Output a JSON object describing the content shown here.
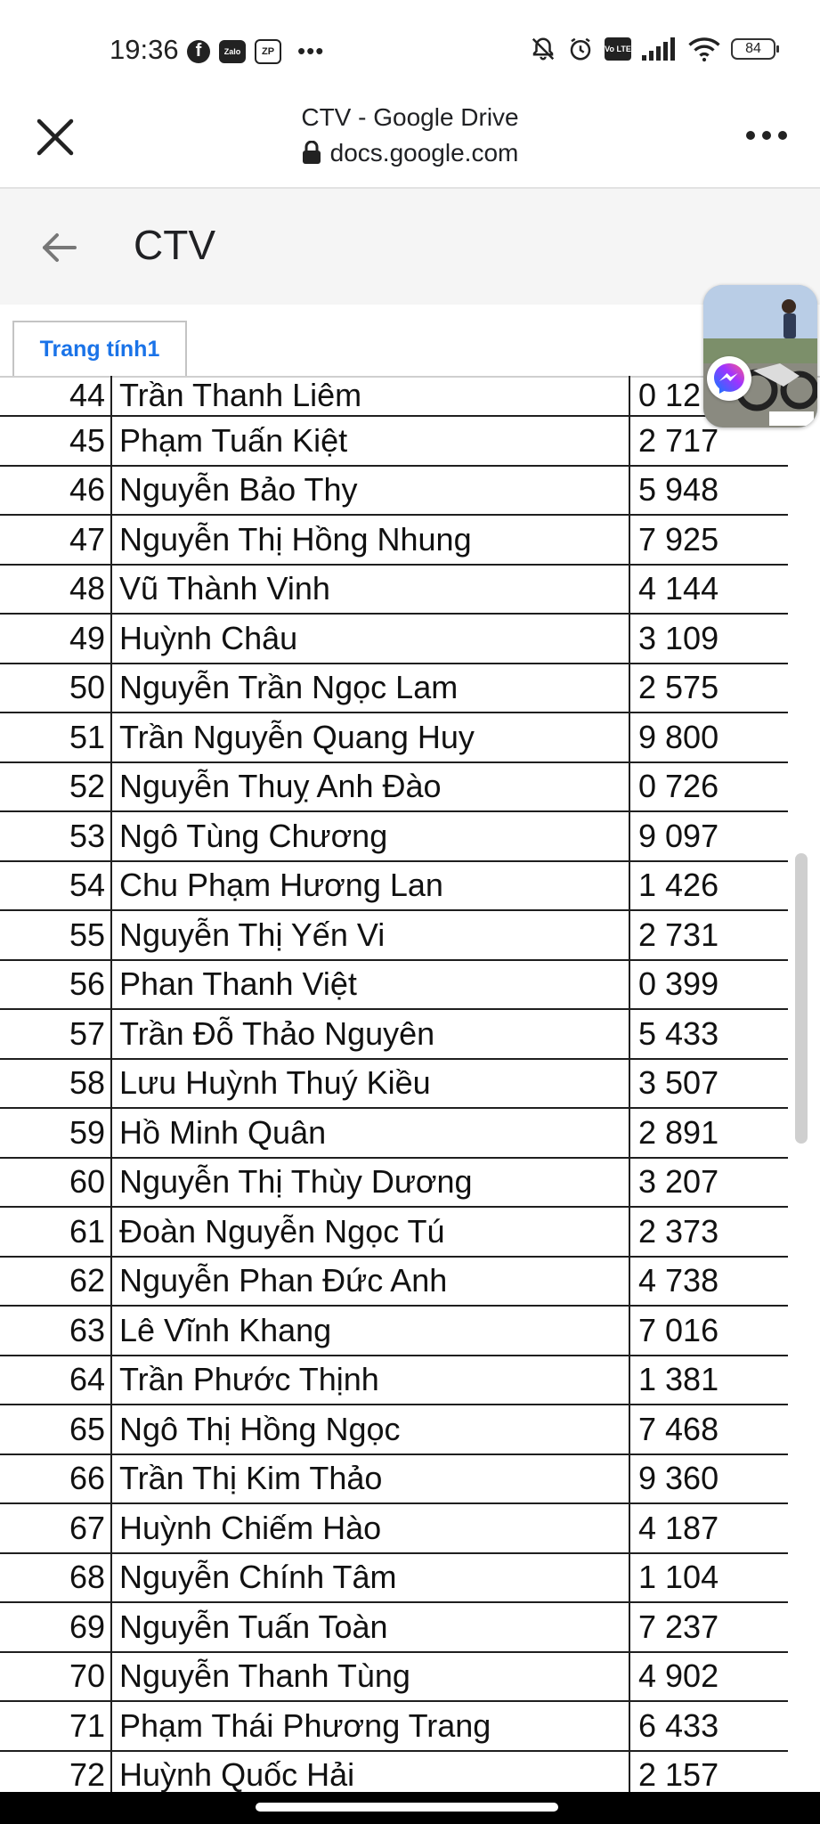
{
  "status_bar": {
    "time": "19:36",
    "left_icons": [
      "facebook-icon",
      "zalo-icon",
      "zp-icon",
      "more-dots-icon"
    ],
    "zalo_label": "Zalo",
    "zp_label": "ZP",
    "right_icons": [
      "mute-bell-icon",
      "alarm-icon",
      "volte-icon",
      "signal-icon",
      "wifi-icon",
      "battery-icon"
    ],
    "volte_label": "Vo LTE",
    "battery": "84"
  },
  "browser": {
    "title": "CTV - Google Drive",
    "url": "docs.google.com"
  },
  "app": {
    "doc_title": "CTV"
  },
  "sheet_tabs": [
    {
      "label": "Trang tính1",
      "active": true
    }
  ],
  "rows": [
    {
      "num": "44",
      "name": "Trần Thanh Liêm",
      "phone": "0 12"
    },
    {
      "num": "45",
      "name": "Phạm Tuấn Kiệt",
      "phone": "2 717"
    },
    {
      "num": "46",
      "name": "Nguyễn Bảo Thy",
      "phone": "5 948"
    },
    {
      "num": "47",
      "name": "Nguyễn Thị Hồng Nhung",
      "phone": "7 925"
    },
    {
      "num": "48",
      "name": "Vũ Thành Vinh",
      "phone": "4 144"
    },
    {
      "num": "49",
      "name": "Huỳnh Châu",
      "phone": "3 109"
    },
    {
      "num": "50",
      "name": "Nguyễn Trần Ngọc Lam",
      "phone": "2 575"
    },
    {
      "num": "51",
      "name": "Trần Nguyễn Quang Huy",
      "phone": "9 800"
    },
    {
      "num": "52",
      "name": "Nguyễn Thuỵ Anh Đào",
      "phone": "0 726"
    },
    {
      "num": "53",
      "name": "Ngô Tùng Chương",
      "phone": "9 097"
    },
    {
      "num": "54",
      "name": "Chu Phạm Hương Lan",
      "phone": "1 426"
    },
    {
      "num": "55",
      "name": "Nguyễn Thị Yến Vi",
      "phone": "2 731"
    },
    {
      "num": "56",
      "name": "Phan Thanh Việt",
      "phone": "0 399"
    },
    {
      "num": "57",
      "name": "Trần Đỗ Thảo Nguyên",
      "phone": "5 433"
    },
    {
      "num": "58",
      "name": "Lưu Huỳnh Thuý Kiều",
      "phone": "3 507"
    },
    {
      "num": "59",
      "name": "Hồ Minh Quân",
      "phone": "2 891"
    },
    {
      "num": "60",
      "name": "Nguyễn Thị Thùy Dương",
      "phone": "3 207"
    },
    {
      "num": "61",
      "name": "Đoàn Nguyễn Ngọc Tú",
      "phone": "2 373"
    },
    {
      "num": "62",
      "name": "Nguyễn Phan Đức Anh",
      "phone": "4 738"
    },
    {
      "num": "63",
      "name": "Lê Vĩnh Khang",
      "phone": "7 016"
    },
    {
      "num": "64",
      "name": "Trần Phước Thịnh",
      "phone": "1 381"
    },
    {
      "num": "65",
      "name": "Ngô Thị Hồng Ngọc",
      "phone": "7 468"
    },
    {
      "num": "66",
      "name": "Trần Thị Kim Thảo",
      "phone": "9 360"
    },
    {
      "num": "67",
      "name": "Huỳnh Chiếm Hào",
      "phone": "4 187"
    },
    {
      "num": "68",
      "name": "Nguyễn Chính Tâm",
      "phone": "1 104"
    },
    {
      "num": "69",
      "name": "Nguyễn Tuấn Toàn",
      "phone": "7 237"
    },
    {
      "num": "70",
      "name": "Nguyễn Thanh Tùng",
      "phone": "4 902"
    },
    {
      "num": "71",
      "name": "Phạm Thái Phương Trang",
      "phone": "6 433"
    },
    {
      "num": "72",
      "name": "Huỳnh Quốc Hải",
      "phone": "2 157"
    }
  ],
  "overlay": {
    "chat_head_icon": "messenger-icon",
    "accent_color": "#1a73e8"
  }
}
